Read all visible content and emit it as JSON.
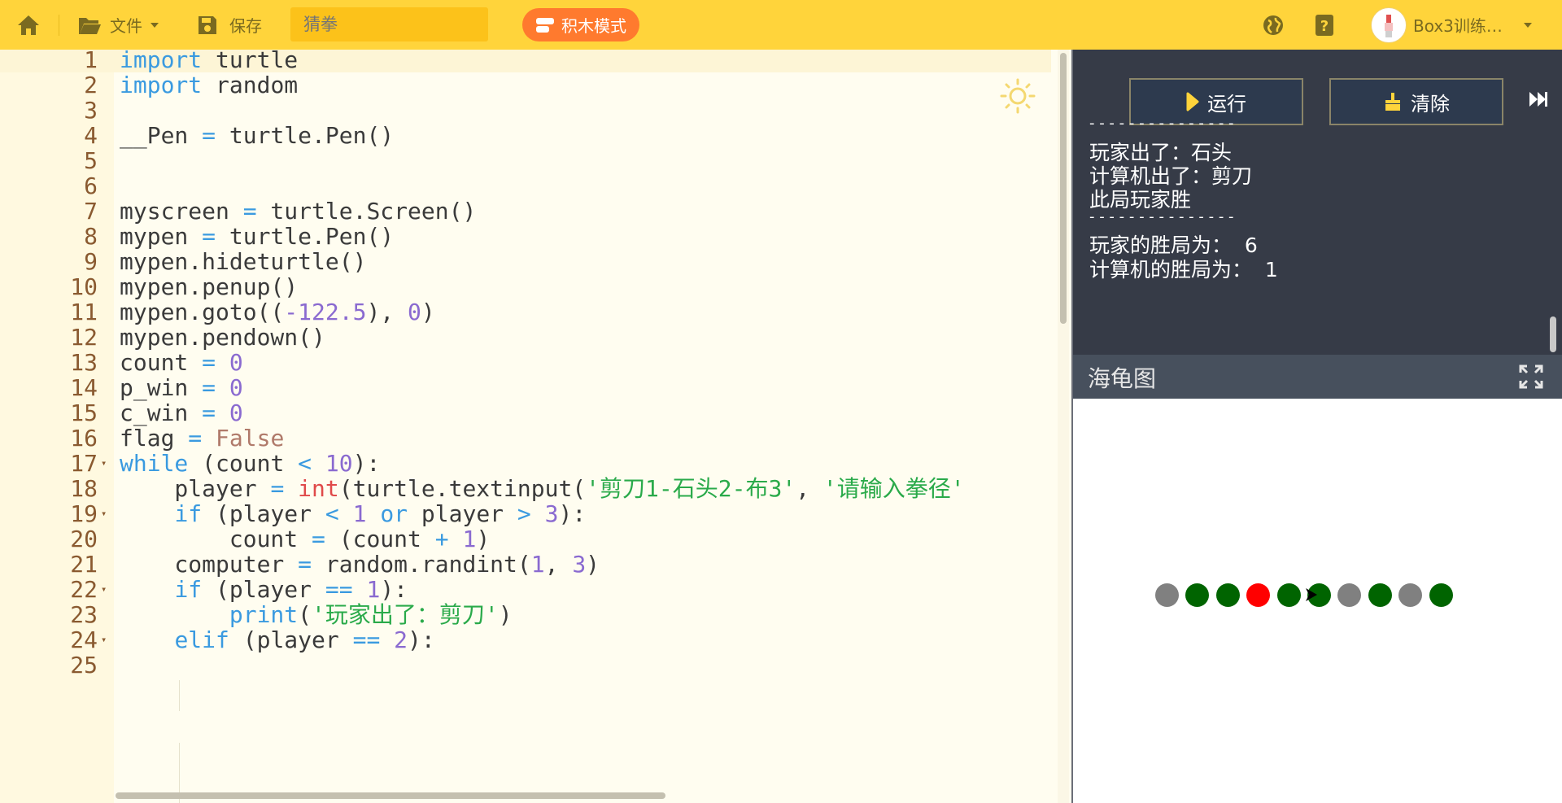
{
  "toolbar": {
    "file_label": "文件",
    "save_label": "保存",
    "title_placeholder": "猜拳",
    "block_mode_label": "积木模式",
    "username": "Box3训练…"
  },
  "code_lines": [
    {
      "n": "1",
      "parts": [
        [
          "k",
          "import"
        ],
        [
          "p",
          " turtle"
        ]
      ]
    },
    {
      "n": "2",
      "parts": [
        [
          "k",
          "import"
        ],
        [
          "p",
          " random"
        ]
      ]
    },
    {
      "n": "3",
      "parts": []
    },
    {
      "n": "4",
      "parts": [
        [
          "p",
          "__Pen "
        ],
        [
          "o",
          "="
        ],
        [
          "p",
          " turtle.Pen()"
        ]
      ]
    },
    {
      "n": "5",
      "parts": []
    },
    {
      "n": "6",
      "parts": []
    },
    {
      "n": "7",
      "parts": [
        [
          "p",
          "myscreen "
        ],
        [
          "o",
          "="
        ],
        [
          "p",
          " turtle.Screen()"
        ]
      ]
    },
    {
      "n": "8",
      "parts": [
        [
          "p",
          "mypen "
        ],
        [
          "o",
          "="
        ],
        [
          "p",
          " turtle.Pen()"
        ]
      ]
    },
    {
      "n": "9",
      "parts": [
        [
          "p",
          "mypen.hideturtle()"
        ]
      ]
    },
    {
      "n": "10",
      "parts": [
        [
          "p",
          "mypen.penup()"
        ]
      ]
    },
    {
      "n": "11",
      "parts": [
        [
          "p",
          "mypen.goto(("
        ],
        [
          "n",
          "-122.5"
        ],
        [
          "p",
          "), "
        ],
        [
          "n",
          "0"
        ],
        [
          "p",
          ")"
        ]
      ]
    },
    {
      "n": "12",
      "parts": [
        [
          "p",
          "mypen.pendown()"
        ]
      ]
    },
    {
      "n": "13",
      "parts": [
        [
          "p",
          "count "
        ],
        [
          "o",
          "="
        ],
        [
          "p",
          " "
        ],
        [
          "n",
          "0"
        ]
      ]
    },
    {
      "n": "14",
      "parts": [
        [
          "p",
          "p_win "
        ],
        [
          "o",
          "="
        ],
        [
          "p",
          " "
        ],
        [
          "n",
          "0"
        ]
      ]
    },
    {
      "n": "15",
      "parts": [
        [
          "p",
          "c_win "
        ],
        [
          "o",
          "="
        ],
        [
          "p",
          " "
        ],
        [
          "n",
          "0"
        ]
      ]
    },
    {
      "n": "16",
      "parts": [
        [
          "p",
          "flag "
        ],
        [
          "o",
          "="
        ],
        [
          "p",
          " "
        ],
        [
          "c",
          "False"
        ]
      ]
    },
    {
      "n": "17",
      "fold": true,
      "parts": [
        [
          "k",
          "while"
        ],
        [
          "p",
          " (count "
        ],
        [
          "o",
          "<"
        ],
        [
          "p",
          " "
        ],
        [
          "n",
          "10"
        ],
        [
          "p",
          "):"
        ]
      ]
    },
    {
      "n": "18",
      "parts": [
        [
          "p",
          "    player "
        ],
        [
          "o",
          "="
        ],
        [
          "p",
          " "
        ],
        [
          "f",
          "int"
        ],
        [
          "p",
          "(turtle.textinput("
        ],
        [
          "s",
          "'剪刀1-石头2-布3'"
        ],
        [
          "p",
          ", "
        ],
        [
          "s",
          "'请输入拳径'"
        ]
      ]
    },
    {
      "n": "19",
      "fold": true,
      "parts": [
        [
          "p",
          "    "
        ],
        [
          "k",
          "if"
        ],
        [
          "p",
          " (player "
        ],
        [
          "o",
          "<"
        ],
        [
          "p",
          " "
        ],
        [
          "n",
          "1"
        ],
        [
          "p",
          " "
        ],
        [
          "k",
          "or"
        ],
        [
          "p",
          " player "
        ],
        [
          "o",
          ">"
        ],
        [
          "p",
          " "
        ],
        [
          "n",
          "3"
        ],
        [
          "p",
          "):"
        ]
      ]
    },
    {
      "n": "20",
      "parts": [
        [
          "p",
          "        count "
        ],
        [
          "o",
          "="
        ],
        [
          "p",
          " (count "
        ],
        [
          "o",
          "+"
        ],
        [
          "p",
          " "
        ],
        [
          "n",
          "1"
        ],
        [
          "p",
          ")"
        ]
      ]
    },
    {
      "n": "21",
      "parts": [
        [
          "p",
          "    computer "
        ],
        [
          "o",
          "="
        ],
        [
          "p",
          " random.randint("
        ],
        [
          "n",
          "1"
        ],
        [
          "p",
          ", "
        ],
        [
          "n",
          "3"
        ],
        [
          "p",
          ")"
        ]
      ]
    },
    {
      "n": "22",
      "fold": true,
      "parts": [
        [
          "p",
          "    "
        ],
        [
          "k",
          "if"
        ],
        [
          "p",
          " (player "
        ],
        [
          "o",
          "=="
        ],
        [
          "p",
          " "
        ],
        [
          "n",
          "1"
        ],
        [
          "p",
          "):"
        ]
      ]
    },
    {
      "n": "23",
      "parts": [
        [
          "p",
          "        "
        ],
        [
          "k",
          "print"
        ],
        [
          "p",
          "("
        ],
        [
          "s",
          "'玩家出了：剪刀'"
        ],
        [
          "p",
          ")"
        ]
      ]
    },
    {
      "n": "24",
      "fold": true,
      "parts": [
        [
          "p",
          "    "
        ],
        [
          "k",
          "elif"
        ],
        [
          "p",
          " (player "
        ],
        [
          "o",
          "=="
        ],
        [
          "p",
          " "
        ],
        [
          "n",
          "2"
        ],
        [
          "p",
          "):"
        ]
      ]
    },
    {
      "n": "25",
      "parts": []
    }
  ],
  "console": {
    "run_label": "运行",
    "clear_label": "清除",
    "lines": [
      "- - - - - - - - - - - - - - -",
      "玩家出了：石头",
      "计算机出了：剪刀",
      "此局玩家胜",
      "- - - - - - - - - - - - - - -",
      "玩家的胜局为：  6",
      "计算机的胜局为：  1"
    ]
  },
  "turtle_panel": {
    "title": "海龟图",
    "dots": [
      {
        "color": "#808080"
      },
      {
        "color": "#006400"
      },
      {
        "color": "#006400"
      },
      {
        "color": "#ff0000"
      },
      {
        "color": "#006400"
      },
      {
        "color": "#006400"
      },
      {
        "color": "#808080"
      },
      {
        "color": "#006400"
      },
      {
        "color": "#808080"
      },
      {
        "color": "#006400"
      }
    ]
  },
  "colors": {
    "toolbar_bg": "#ffd43b",
    "accent_orange": "#ff7a2e",
    "console_bg": "#363b47"
  }
}
